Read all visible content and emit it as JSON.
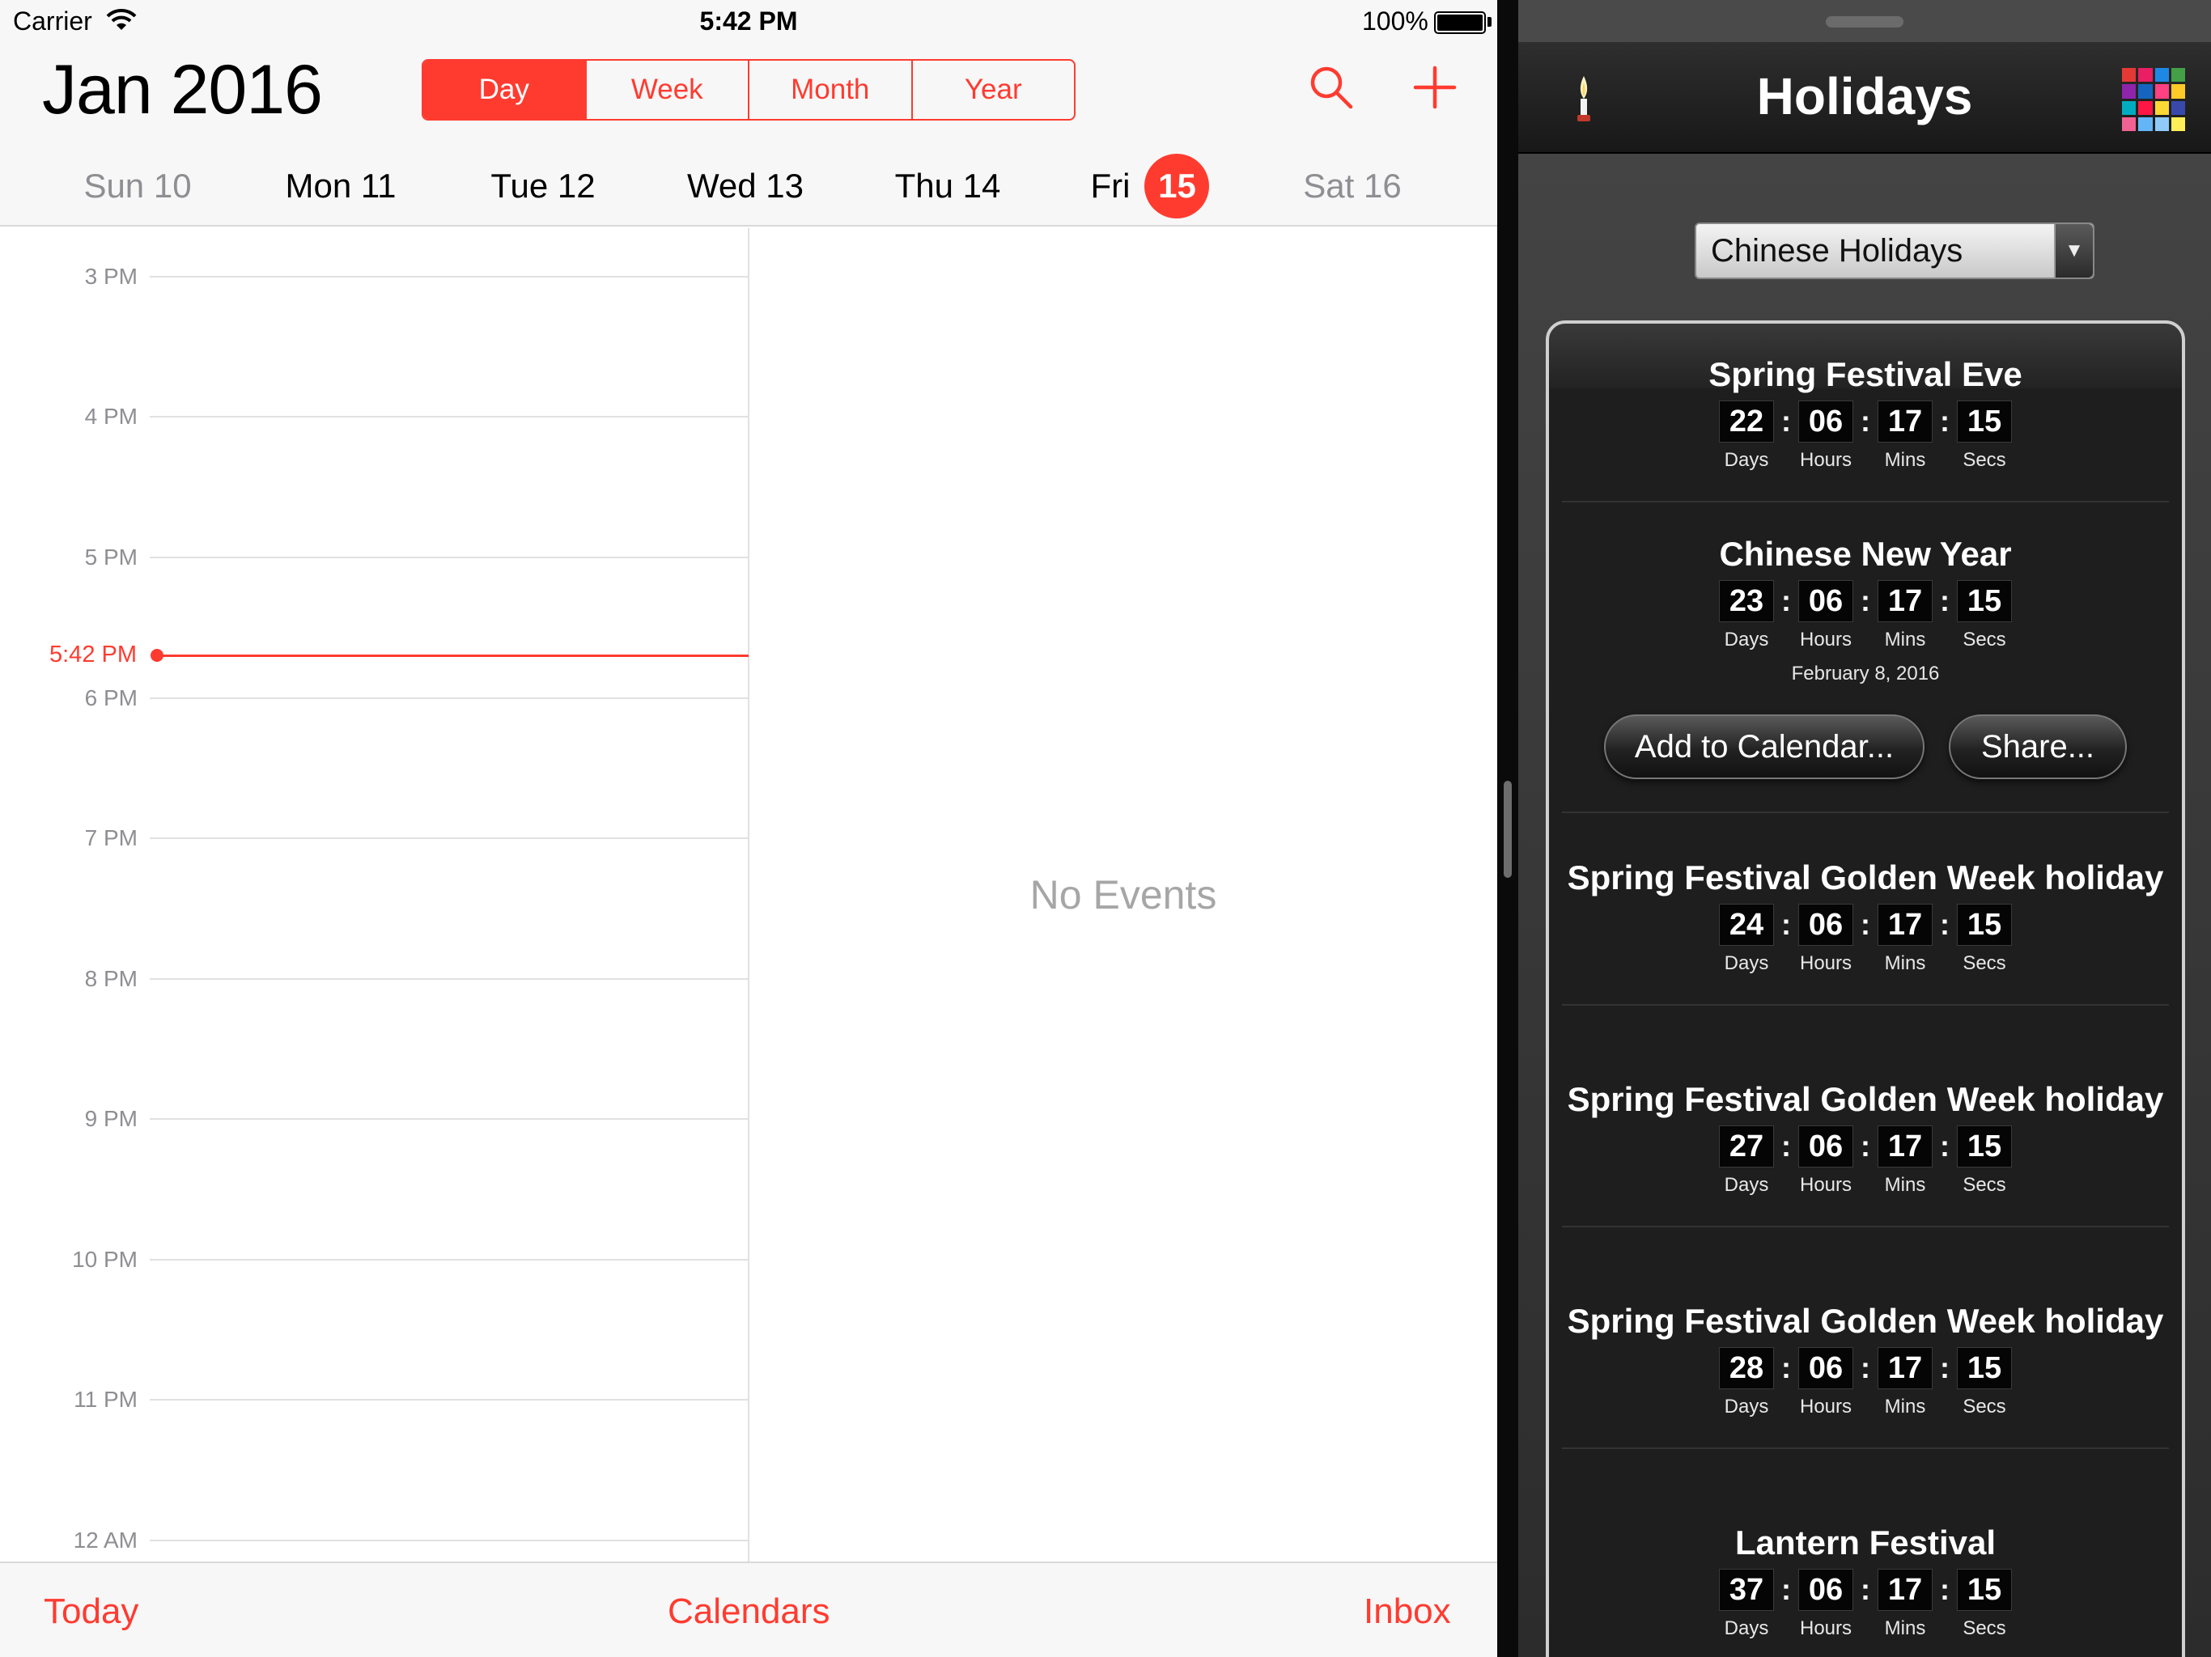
{
  "status": {
    "carrier": "Carrier",
    "time": "5:42 PM",
    "battery": "100%"
  },
  "calendar": {
    "month": "Jan",
    "year": "2016",
    "view_tabs": [
      {
        "label": "Day",
        "active": true
      },
      {
        "label": "Week",
        "active": false
      },
      {
        "label": "Month",
        "active": false
      },
      {
        "label": "Year",
        "active": false
      }
    ],
    "weekdays": [
      {
        "day": "Sun",
        "num": "10",
        "dim": true
      },
      {
        "day": "Mon",
        "num": "11",
        "dim": false
      },
      {
        "day": "Tue",
        "num": "12",
        "dim": false
      },
      {
        "day": "Wed",
        "num": "13",
        "dim": false
      },
      {
        "day": "Thu",
        "num": "14",
        "dim": false
      },
      {
        "day": "Fri",
        "num": "15",
        "selected": true
      },
      {
        "day": "Sat",
        "num": "16",
        "dim": true
      }
    ],
    "hours": [
      "3 PM",
      "4 PM",
      "5 PM",
      "6 PM",
      "7 PM",
      "8 PM",
      "9 PM",
      "10 PM",
      "11 PM",
      "12 AM"
    ],
    "now_label": "5:42 PM",
    "empty_text": "No Events",
    "bottom_tabs": {
      "today": "Today",
      "calendars": "Calendars",
      "inbox": "Inbox"
    },
    "accent": "#ff3b30"
  },
  "holidays": {
    "title": "Holidays",
    "selector": "Chinese Holidays",
    "unit_labels": {
      "days": "Days",
      "hours": "Hours",
      "mins": "Mins",
      "secs": "Secs"
    },
    "items": [
      {
        "name": "Spring Festival Eve",
        "days": "22",
        "hours": "06",
        "mins": "17",
        "secs": "15"
      },
      {
        "name": "Chinese New Year",
        "days": "23",
        "hours": "06",
        "mins": "17",
        "secs": "15",
        "date": "February 8, 2016",
        "add_label": "Add to Calendar...",
        "share_label": "Share..."
      },
      {
        "name": "Spring Festival Golden Week holiday",
        "days": "24",
        "hours": "06",
        "mins": "17",
        "secs": "15"
      },
      {
        "name": "Spring Festival Golden Week holiday",
        "days": "27",
        "hours": "06",
        "mins": "17",
        "secs": "15"
      },
      {
        "name": "Spring Festival Golden Week holiday",
        "days": "28",
        "hours": "06",
        "mins": "17",
        "secs": "15"
      },
      {
        "name": "Lantern Festival",
        "days": "37",
        "hours": "06",
        "mins": "17",
        "secs": "15"
      }
    ]
  }
}
